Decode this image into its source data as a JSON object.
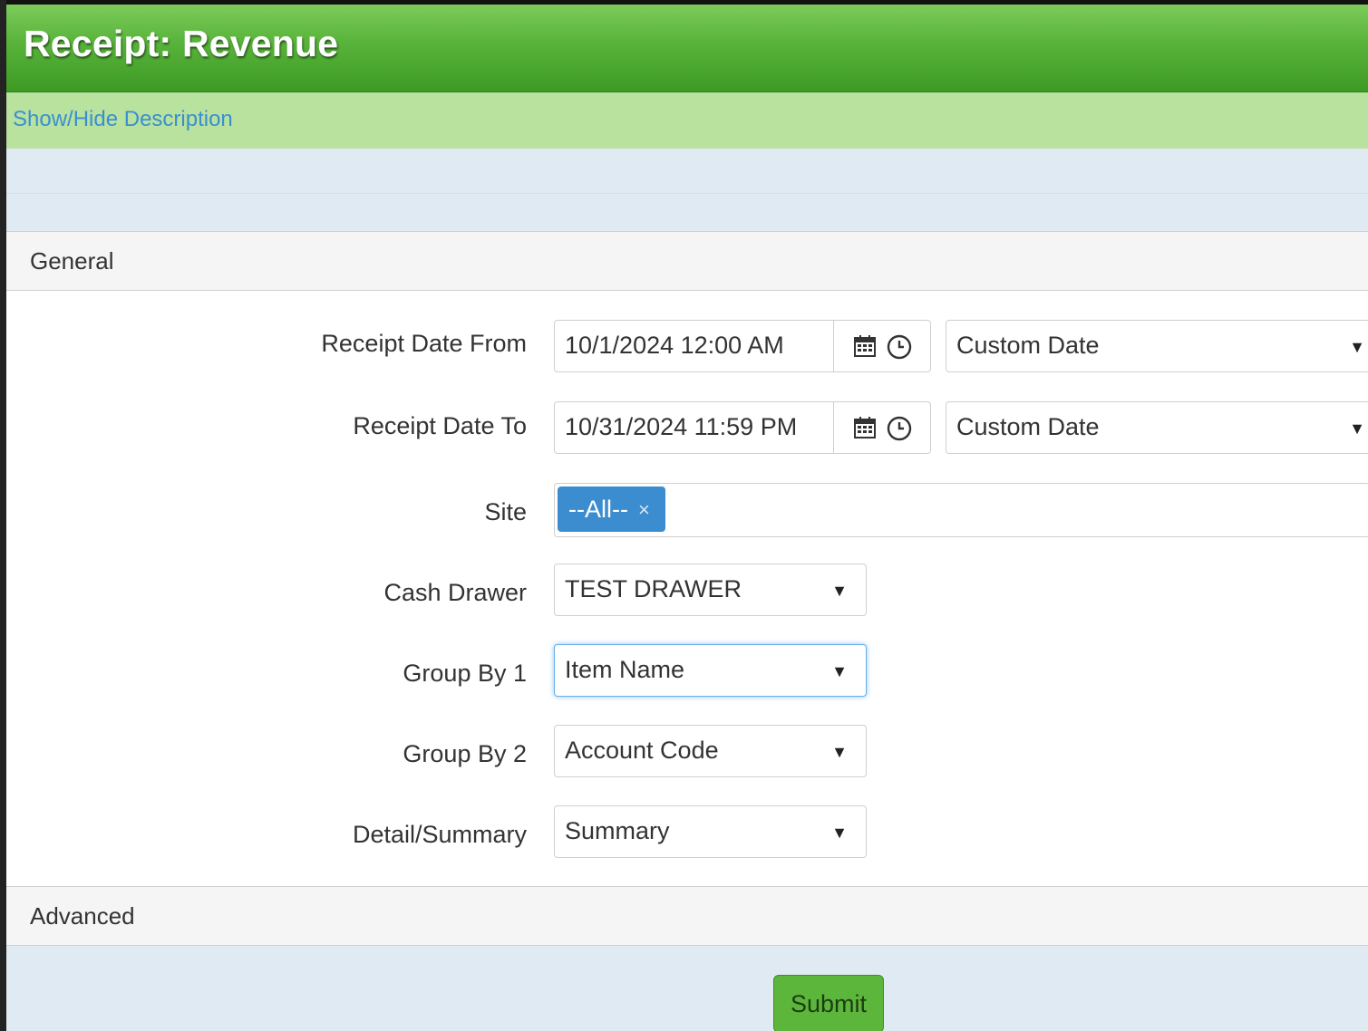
{
  "page": {
    "title": "Receipt: Revenue",
    "description_toggle": "Show/Hide Description"
  },
  "sections": {
    "general": "General",
    "advanced": "Advanced"
  },
  "form": {
    "receipt_date_from": {
      "label": "Receipt Date From",
      "value": "10/1/2024 12:00 AM",
      "preset": "Custom Date"
    },
    "receipt_date_to": {
      "label": "Receipt Date To",
      "value": "10/31/2024 11:59 PM",
      "preset": "Custom Date"
    },
    "site": {
      "label": "Site",
      "tag": "--All--",
      "remove": "×"
    },
    "cash_drawer": {
      "label": "Cash Drawer",
      "value": "TEST DRAWER"
    },
    "group_by_1": {
      "label": "Group By 1",
      "value": "Item Name"
    },
    "group_by_2": {
      "label": "Group By 2",
      "value": "Account Code"
    },
    "detail_summary": {
      "label": "Detail/Summary",
      "value": "Summary"
    }
  },
  "icons": {
    "calendar": "calendar-icon",
    "clock": "clock-icon",
    "dropdown": "▼"
  },
  "actions": {
    "submit": "Submit"
  },
  "colors": {
    "title_green": "#58b33a",
    "description_bar": "#b8e29e",
    "link_blue": "#3a8fd2",
    "tag_blue": "#3c8dcf",
    "submit_green": "#5cb63c",
    "panel_blue": "#dfeaf3"
  }
}
